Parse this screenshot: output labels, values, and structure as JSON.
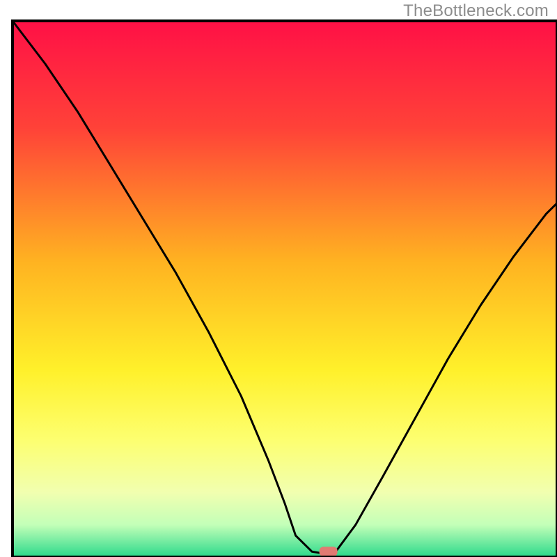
{
  "watermark": "TheBottleneck.com",
  "chart_data": {
    "type": "line",
    "title": "",
    "xlabel": "",
    "ylabel": "",
    "xlim": [
      0,
      100
    ],
    "ylim": [
      0,
      100
    ],
    "grid": false,
    "legend": false,
    "series": [
      {
        "name": "bottleneck-curve",
        "x": [
          0,
          6,
          12,
          18,
          24,
          30,
          36,
          42,
          47,
          50,
          52,
          55,
          58,
          59,
          63,
          68,
          74,
          80,
          86,
          92,
          98,
          100
        ],
        "y": [
          100,
          92,
          83,
          73,
          63,
          53,
          42,
          30,
          18,
          10,
          4,
          1,
          0.5,
          0.5,
          6,
          15,
          26,
          37,
          47,
          56,
          64,
          66
        ]
      }
    ],
    "marker": {
      "x": 58,
      "y": 1
    },
    "gradient_stops": [
      {
        "offset": 0,
        "color": "#ff1046"
      },
      {
        "offset": 20,
        "color": "#ff4238"
      },
      {
        "offset": 45,
        "color": "#ffb321"
      },
      {
        "offset": 65,
        "color": "#fff02a"
      },
      {
        "offset": 78,
        "color": "#fdff6f"
      },
      {
        "offset": 88,
        "color": "#f1ffb0"
      },
      {
        "offset": 94,
        "color": "#c3ffb8"
      },
      {
        "offset": 100,
        "color": "#2bd98b"
      }
    ],
    "frame_color": "#000000",
    "curve_color": "#000000",
    "marker_color": "#e17a72"
  }
}
